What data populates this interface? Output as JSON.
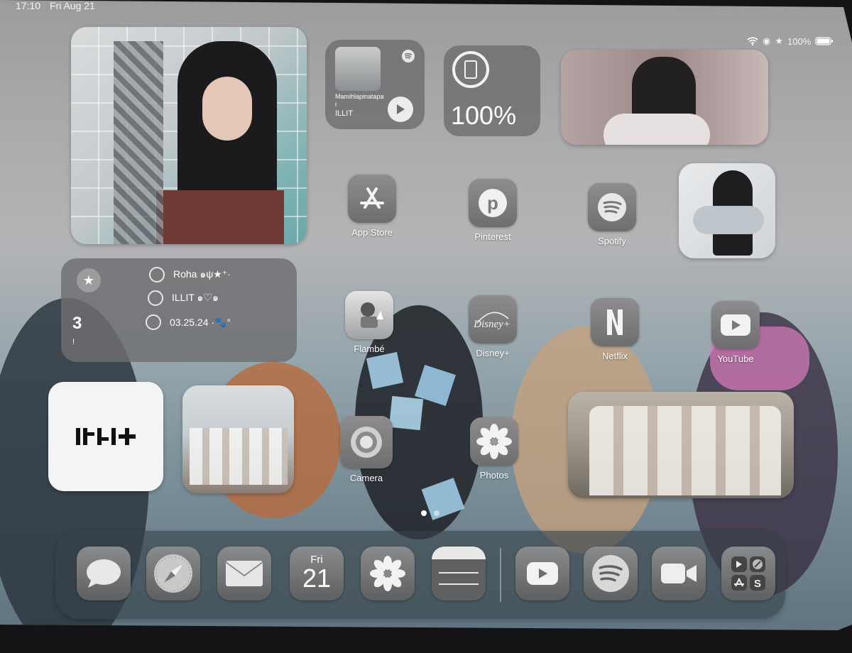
{
  "status_bar": {
    "time": "17:10",
    "date": "Fri Aug 21",
    "battery": "100%"
  },
  "music_widget": {
    "song": "Mamihlapinatapa",
    "song_suffix": "i",
    "artist": "ILLIT"
  },
  "battery_widget": {
    "percent": "100%"
  },
  "reminders_widget": {
    "count": "3",
    "mark": "!",
    "items": [
      {
        "label": "Roha ๑ψ★⁺·"
      },
      {
        "label": "ILLIT ๑♡๑"
      },
      {
        "label": "03.25.24 ·🐾°"
      }
    ]
  },
  "logo_widget": {
    "text": "ILLIT"
  },
  "apps": {
    "app_store": {
      "label": "App Store"
    },
    "pinterest": {
      "label": "Pinterest"
    },
    "spotify": {
      "label": "Spotify"
    },
    "flambe": {
      "label": "Flambé"
    },
    "disney": {
      "label": "Disney+"
    },
    "netflix": {
      "label": "Netflix"
    },
    "youtube": {
      "label": "YouTube"
    },
    "camera": {
      "label": "Camera"
    },
    "photos": {
      "label": "Photos"
    }
  },
  "dock": {
    "calendar_day": "Fri",
    "calendar_date": "21",
    "apps": [
      "Messages",
      "Safari",
      "Mail",
      "Calendar",
      "Photos",
      "Notes",
      "YouTube",
      "Spotify",
      "FaceTime",
      "App Library"
    ]
  },
  "page_indicator": {
    "pages": 2,
    "current": 1
  },
  "icons": {
    "wifi": "wifi-icon",
    "battery": "battery-icon",
    "star": "star-icon",
    "play": "play-icon",
    "spotify": "spotify-icon"
  },
  "colors": {
    "widget_glass": "#6e6e70",
    "label": "#ffffff",
    "dock": "#37424a"
  }
}
